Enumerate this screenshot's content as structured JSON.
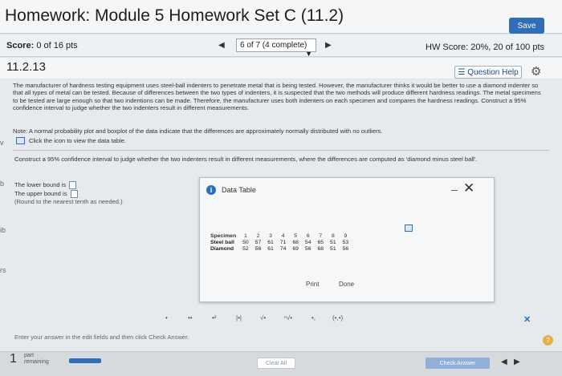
{
  "header": {
    "title": "Homework: Module 5 Homework Set C (11.2)",
    "save_label": "Save"
  },
  "scorebar": {
    "score_label": "Score:",
    "score_value": "0 of 16 pts",
    "nav_value": "6 of 7 (4 complete)",
    "hw_score": "HW Score: 20%, 20 of 100 pts"
  },
  "question": {
    "number": "11.2.13",
    "help_label": "Question Help",
    "problem_text": "The manufacturer of hardness testing equipment uses steel-ball indenters to penetrate metal that is being tested. However, the manufacturer thinks it would be better to use a diamond indenter so that all types of metal can be tested. Because of differences between the two types of indenters, it is suspected that the two methods will produce different hardness readings. The metal specimens to be tested are large enough so that two indentions can be made. Therefore, the manufacturer uses both indenters on each specimen and compares the hardness readings. Construct a 95% confidence interval to judge whether the two indenters result in different measurements.",
    "note_text": "Note: A normal probability plot and boxplot of the data indicate that the differences are approximately normally distributed with no outliers.",
    "click_text": "Click the icon to view the data table.",
    "instruction_text": "Construct a 95% confidence interval to judge whether the two indenters result in different measurements, where the differences are computed as 'diamond minus steel ball'.",
    "lower_label": "The lower bound is",
    "upper_label": "The upper bound is",
    "round_label": "(Round to the nearest tenth as needed.)"
  },
  "side_labels": {
    "b": "b",
    "ib": "ib",
    "rs": "rs",
    "v": "v"
  },
  "dialog": {
    "title": "Data Table",
    "print_label": "Print",
    "done_label": "Done",
    "table": {
      "header_label": "Specimen",
      "specimens": [
        "1",
        "2",
        "3",
        "4",
        "5",
        "6",
        "7",
        "8",
        "9"
      ],
      "rows": [
        {
          "label": "Steel ball",
          "values": [
            "50",
            "57",
            "61",
            "71",
            "68",
            "54",
            "65",
            "51",
            "53"
          ]
        },
        {
          "label": "Diamond",
          "values": [
            "52",
            "56",
            "61",
            "74",
            "69",
            "56",
            "68",
            "51",
            "56"
          ]
        }
      ]
    }
  },
  "toolbar": {
    "items": [
      "•",
      "••",
      "•²",
      "|•|",
      "√•",
      "ⁿ√•",
      "•,",
      "(•,•)"
    ]
  },
  "footer": {
    "enter_text": "Enter your answer in the edit fields and then click Check Answer.",
    "part_number": "1",
    "part_label": "part",
    "remaining_label": "remaining",
    "progress": 1.0,
    "clear_label": "Clear All",
    "check_label": "Check Answer"
  }
}
